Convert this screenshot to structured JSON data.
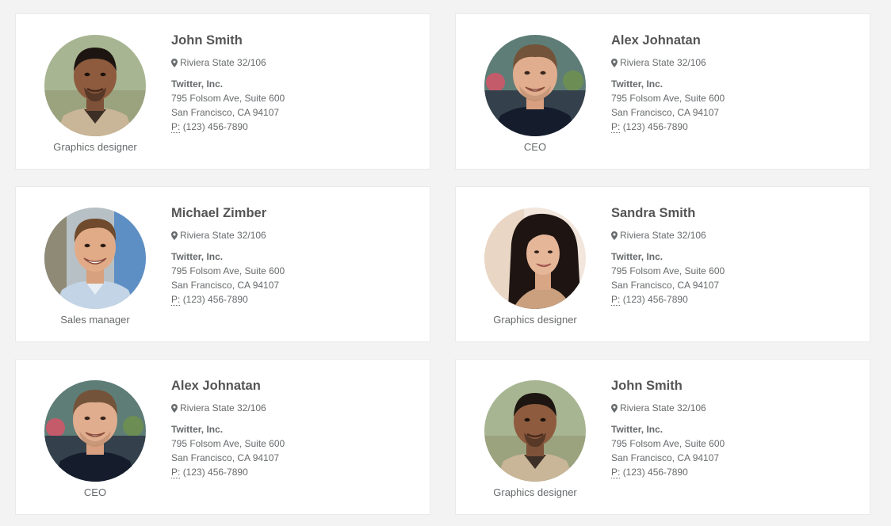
{
  "cards": [
    {
      "name": "John Smith",
      "role": "Graphics designer",
      "location": "Riviera State 32/106",
      "company": "Twitter, Inc.",
      "address1": "795 Folsom Ave, Suite 600",
      "address2": "San Francisco, CA 94107",
      "phone_label": "P:",
      "phone": "(123) 456-7890",
      "avatar": "avatar-john"
    },
    {
      "name": "Alex Johnatan",
      "role": "CEO",
      "location": "Riviera State 32/106",
      "company": "Twitter, Inc.",
      "address1": "795 Folsom Ave, Suite 600",
      "address2": "San Francisco, CA 94107",
      "phone_label": "P:",
      "phone": "(123) 456-7890",
      "avatar": "avatar-alex"
    },
    {
      "name": "Michael Zimber",
      "role": "Sales manager",
      "location": "Riviera State 32/106",
      "company": "Twitter, Inc.",
      "address1": "795 Folsom Ave, Suite 600",
      "address2": "San Francisco, CA 94107",
      "phone_label": "P:",
      "phone": "(123) 456-7890",
      "avatar": "avatar-michael"
    },
    {
      "name": "Sandra Smith",
      "role": "Graphics designer",
      "location": "Riviera State 32/106",
      "company": "Twitter, Inc.",
      "address1": "795 Folsom Ave, Suite 600",
      "address2": "San Francisco, CA 94107",
      "phone_label": "P:",
      "phone": "(123) 456-7890",
      "avatar": "avatar-sandra"
    },
    {
      "name": "Alex Johnatan",
      "role": "CEO",
      "location": "Riviera State 32/106",
      "company": "Twitter, Inc.",
      "address1": "795 Folsom Ave, Suite 600",
      "address2": "San Francisco, CA 94107",
      "phone_label": "P:",
      "phone": "(123) 456-7890",
      "avatar": "avatar-alex"
    },
    {
      "name": "John Smith",
      "role": "Graphics designer",
      "location": "Riviera State 32/106",
      "company": "Twitter, Inc.",
      "address1": "795 Folsom Ave, Suite 600",
      "address2": "San Francisco, CA 94107",
      "phone_label": "P:",
      "phone": "(123) 456-7890",
      "avatar": "avatar-john"
    }
  ],
  "icons": {
    "location": "map-marker-icon"
  },
  "colors": {
    "page_background": "#f3f3f4",
    "card_background": "#ffffff",
    "card_border": "#e7eaec",
    "text": "#676a6c",
    "name_text": "#555555"
  }
}
